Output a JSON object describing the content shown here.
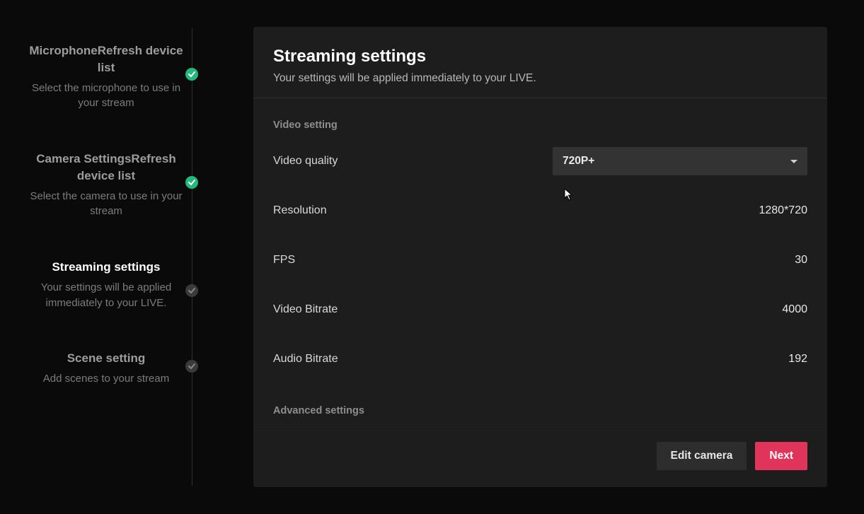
{
  "sidebar": {
    "steps": [
      {
        "title": "MicrophoneRefresh device list",
        "subtitle": "Select the microphone to use in your stream",
        "status": "done"
      },
      {
        "title": "Camera SettingsRefresh device list",
        "subtitle": "Select the camera to use in your stream",
        "status": "done"
      },
      {
        "title": "Streaming settings",
        "subtitle": "Your settings will be applied immediately to your LIVE.",
        "status": "todo",
        "active": true
      },
      {
        "title": "Scene setting",
        "subtitle": "Add scenes to your stream",
        "status": "todo"
      }
    ]
  },
  "panel": {
    "title": "Streaming settings",
    "subtitle": "Your settings will be applied immediately to your LIVE.",
    "sections": {
      "video_label": "Video setting",
      "advanced_label": "Advanced settings"
    },
    "video_quality_label": "Video quality",
    "video_quality_value": "720P+",
    "rows": [
      {
        "label": "Resolution",
        "value": "1280*720"
      },
      {
        "label": "FPS",
        "value": "30"
      },
      {
        "label": "Video Bitrate",
        "value": "4000"
      },
      {
        "label": "Audio Bitrate",
        "value": "192"
      }
    ],
    "footer": {
      "edit_label": "Edit camera",
      "next_label": "Next"
    }
  }
}
